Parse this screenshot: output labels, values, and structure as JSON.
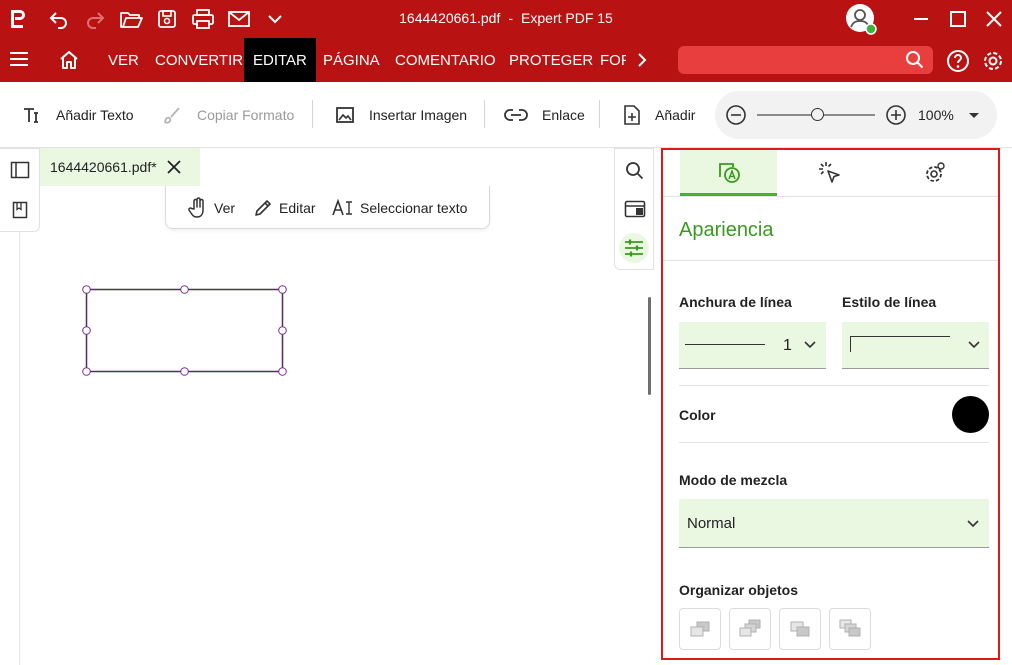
{
  "window": {
    "file_name": "1644420661.pdf",
    "separator": "-",
    "app_name": "Expert PDF 15"
  },
  "ribbon": {
    "tabs": [
      {
        "label": "VER"
      },
      {
        "label": "CONVERTIR"
      },
      {
        "label": "EDITAR"
      },
      {
        "label": "PÁGINA"
      },
      {
        "label": "COMENTARIO"
      },
      {
        "label": "PROTEGER"
      },
      {
        "label": "FOF"
      }
    ],
    "active_tab": "EDITAR"
  },
  "toolbar": {
    "add_text": "Añadir Texto",
    "copy_format": "Copiar Formato",
    "insert_image": "Insertar Imagen",
    "link": "Enlace",
    "add": "Añadir",
    "zoom": "100%"
  },
  "document": {
    "tab_label": "1644420661.pdf*"
  },
  "modes": {
    "view": "Ver",
    "edit": "Editar",
    "select_text": "Seleccionar texto"
  },
  "panel": {
    "section_title": "Apariencia",
    "line_width_label": "Anchura de línea",
    "line_width_value": "1",
    "line_style_label": "Estilo de línea",
    "color_label": "Color",
    "color_value": "#000000",
    "blend_mode_label": "Modo de mezcla",
    "blend_mode_value": "Normal",
    "arrange_label": "Organizar objetos"
  },
  "colors": {
    "brand_red": "#b81212",
    "accent_green": "#4caf2a",
    "selection_purple": "#7b2f8e"
  }
}
